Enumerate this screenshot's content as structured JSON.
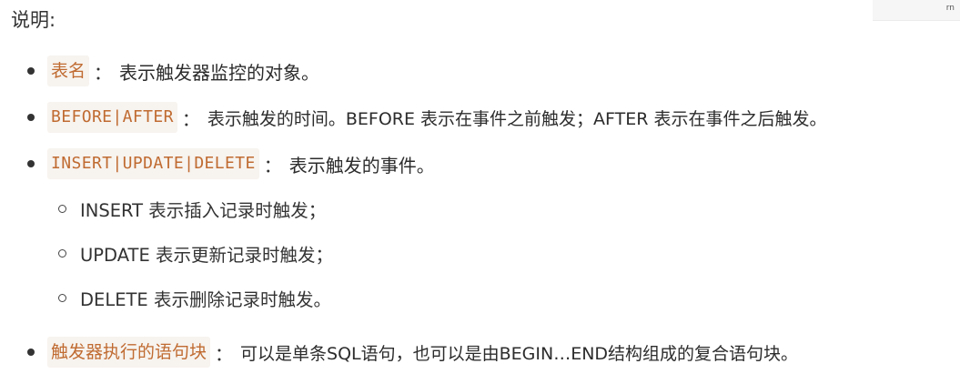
{
  "heading": "说明:",
  "corner_glyph": "rn",
  "items": [
    {
      "term": "表名",
      "separator": "：",
      "desc": "表示触发器监控的对象。"
    },
    {
      "term": "BEFORE|AFTER",
      "separator": "：",
      "desc": "表示触发的时间。BEFORE 表示在事件之前触发；AFTER 表示在事件之后触发。"
    },
    {
      "term": "INSERT|UPDATE|DELETE",
      "separator": "：",
      "desc": "表示触发的事件。"
    },
    {
      "term": "触发器执行的语句块",
      "separator": "：",
      "desc": "可以是单条SQL语句，也可以是由BEGIN…END结构组成的复合语句块。"
    }
  ],
  "subitems": [
    "INSERT 表示插入记录时触发；",
    "UPDATE 表示更新记录时触发；",
    "DELETE 表示删除记录时触发。"
  ]
}
